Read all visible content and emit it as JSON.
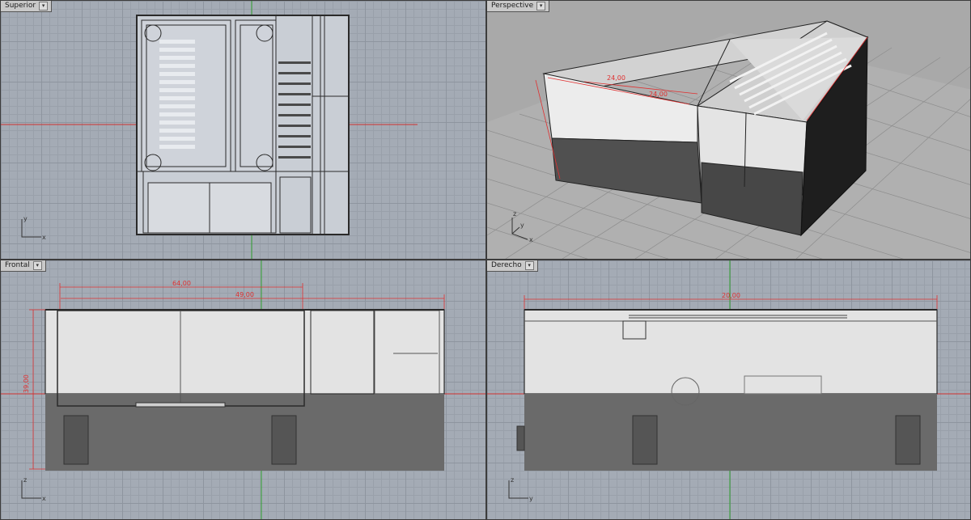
{
  "viewports": {
    "top": {
      "label": "Superior",
      "axis_h": "x",
      "axis_v": "y"
    },
    "perspective": {
      "label": "Perspective",
      "axis_h": "x",
      "axis_v": "y",
      "axis_up": "z",
      "dims": [
        "24,00",
        "24,00"
      ]
    },
    "front": {
      "label": "Frontal",
      "axis_h": "x",
      "axis_v": "z",
      "dims": {
        "width_total": "64,00",
        "width_inner": "49,00",
        "height": "39,00"
      }
    },
    "right": {
      "label": "Derecho",
      "axis_h": "y",
      "axis_v": "z",
      "dims": {
        "depth": "20,00"
      }
    }
  },
  "colors": {
    "grid_bg": "#a4abb5",
    "x_axis": "#d03030",
    "y_axis": "#2fa02f",
    "dimension": "#e03030",
    "model_light": "#e6e6e6",
    "model_dark": "#6a6a6a"
  }
}
